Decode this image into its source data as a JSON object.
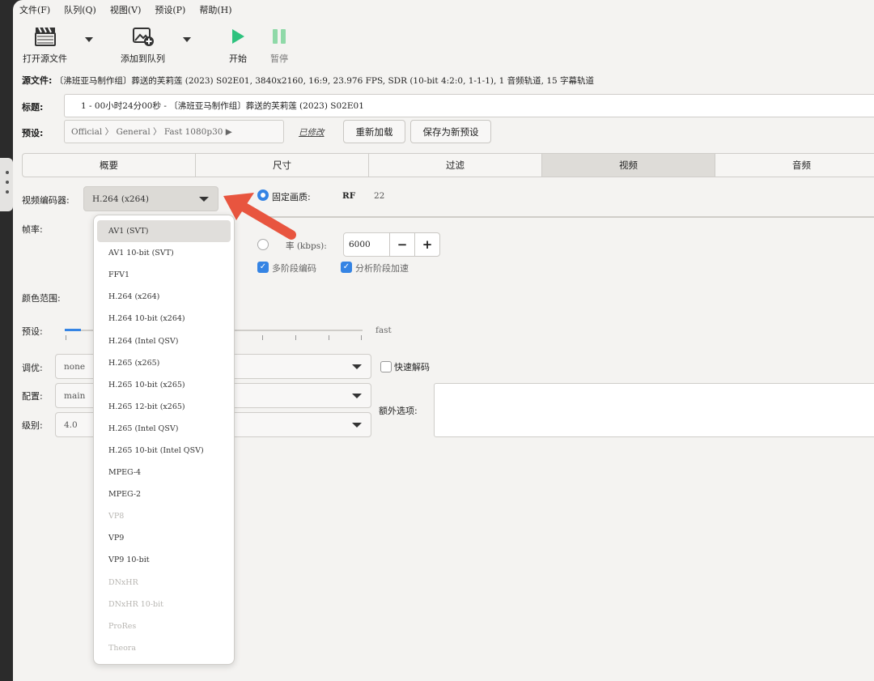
{
  "menu": [
    "文件(F)",
    "队列(Q)",
    "视图(V)",
    "预设(P)",
    "帮助(H)"
  ],
  "toolbar": {
    "open_source": "打开源文件",
    "add_to_queue": "添加到队列",
    "start": "开始",
    "pause": "暂停"
  },
  "source": {
    "label": "源文件:",
    "value": "〔沸班亚马制作组〕葬送的芙莉莲 (2023) S02E01, 3840x2160, 16:9, 23.976 FPS, SDR (10-bit 4:2:0, 1-1-1), 1 音频轨道, 15 字幕轨道"
  },
  "title": {
    "label": "标题:",
    "value": "1 - 00小时24分00秒 - 〔沸班亚马制作组〕葬送的芙莉莲 (2023) S02E01"
  },
  "preset": {
    "label": "预设:",
    "path": "Official  〉 General  〉 Fast 1080p30 ▶",
    "modified": "已修改",
    "reload": "重新加载",
    "save_new": "保存为新预设"
  },
  "tabs": [
    "概要",
    "尺寸",
    "过滤",
    "视频",
    "音频"
  ],
  "active_tab": "视频",
  "video": {
    "encoder_label": "视频编码器:",
    "encoder_value": "H.264 (x264)",
    "framerate_label": "帧率:",
    "color_range_label": "颜色范围:",
    "preset_label": "预设:",
    "preset_speed": "fast",
    "tune_label": "调优:",
    "tune_value": "none",
    "profile_label": "配置:",
    "profile_value": "main",
    "level_label": "级别:",
    "level_value": "4.0",
    "fast_decode": "快速解码",
    "extra_options": "额外选项:",
    "constant_quality": "固定画质:",
    "rf_label": "RF",
    "rf_value": "22",
    "bitrate_label": "率 (kbps):",
    "bitrate_value": "6000",
    "minus": "−",
    "plus": "+",
    "multipass": "多阶段编码",
    "turbo": "分析阶段加速"
  },
  "encoder_options": [
    {
      "label": "AV1 (SVT)",
      "state": "selected"
    },
    {
      "label": "AV1 10-bit (SVT)",
      "state": "normal"
    },
    {
      "label": "FFV1",
      "state": "normal"
    },
    {
      "label": "H.264 (x264)",
      "state": "normal"
    },
    {
      "label": "H.264 10-bit (x264)",
      "state": "normal"
    },
    {
      "label": "H.264 (Intel QSV)",
      "state": "normal"
    },
    {
      "label": "H.265 (x265)",
      "state": "normal"
    },
    {
      "label": "H.265 10-bit (x265)",
      "state": "normal"
    },
    {
      "label": "H.265 12-bit (x265)",
      "state": "normal"
    },
    {
      "label": "H.265 (Intel QSV)",
      "state": "normal"
    },
    {
      "label": "H.265 10-bit (Intel QSV)",
      "state": "normal"
    },
    {
      "label": "MPEG-4",
      "state": "normal"
    },
    {
      "label": "MPEG-2",
      "state": "normal"
    },
    {
      "label": "VP8",
      "state": "disabled"
    },
    {
      "label": "VP9",
      "state": "normal"
    },
    {
      "label": "VP9 10-bit",
      "state": "normal"
    },
    {
      "label": "DNxHR",
      "state": "disabled"
    },
    {
      "label": "DNxHR 10-bit",
      "state": "disabled"
    },
    {
      "label": "ProRes",
      "state": "disabled"
    },
    {
      "label": "Theora",
      "state": "disabled"
    }
  ],
  "colors": {
    "accent": "#3584e4",
    "start_green": "#2ec27e",
    "pause_green": "#8fd9a8",
    "arrow_red": "#e8553f"
  }
}
